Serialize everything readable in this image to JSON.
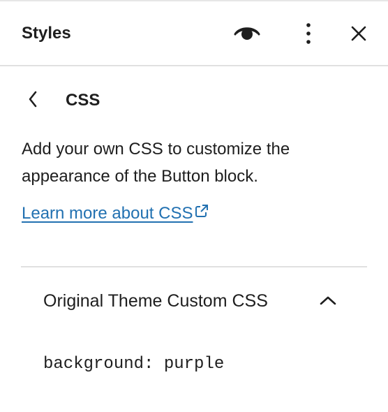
{
  "header": {
    "title": "Styles",
    "actions": {
      "preview_icon": "eye-icon",
      "more_icon": "more-vertical-icon",
      "close_icon": "close-icon"
    }
  },
  "nav": {
    "back_icon": "chevron-left-icon",
    "title": "CSS"
  },
  "description": "Add your own CSS to customize the appearance of the Button block.",
  "learn_more": {
    "label": "Learn more about CSS",
    "icon": "external-link-icon",
    "color": "#2271b1"
  },
  "panel": {
    "title": "Original Theme Custom CSS",
    "toggle_icon": "chevron-up-icon",
    "expanded": true,
    "code": "background: purple"
  }
}
